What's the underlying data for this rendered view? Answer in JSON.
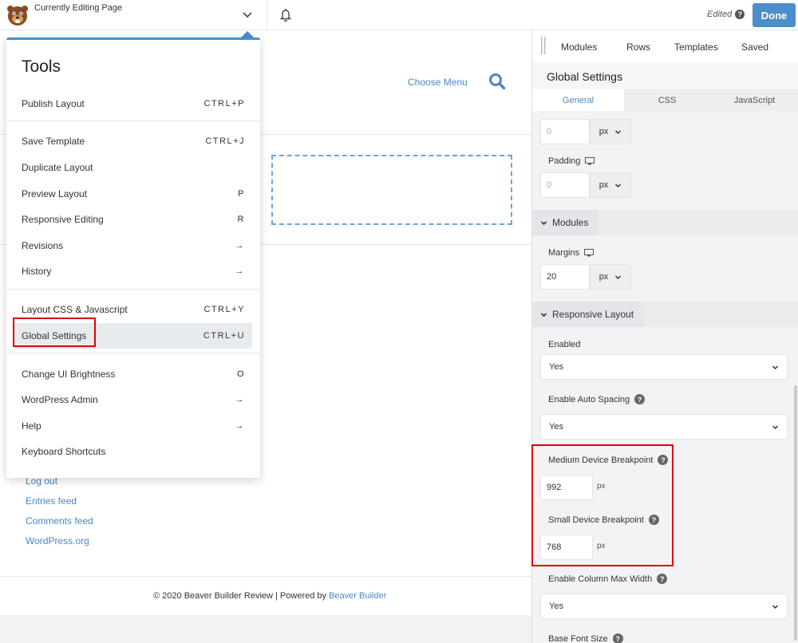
{
  "topbar": {
    "editing_label": "Currently Editing Page",
    "edited_label": "Edited",
    "done_label": "Done",
    "accent": "#4a8ecb"
  },
  "page": {
    "choose_menu": "Choose Menu",
    "links": [
      "Log out",
      "Entries feed",
      "Comments feed",
      "WordPress.org"
    ],
    "footer_text": "© 2020 Beaver Builder Review | Powered by ",
    "footer_link": "Beaver Builder"
  },
  "tools": {
    "title": "Tools",
    "items": [
      {
        "label": "Publish Layout",
        "shortcut": "CTRL+P"
      },
      {
        "label": "Save Template",
        "shortcut": "CTRL+J"
      },
      {
        "label": "Duplicate Layout",
        "shortcut": ""
      },
      {
        "label": "Preview Layout",
        "shortcut": "P"
      },
      {
        "label": "Responsive Editing",
        "shortcut": "R"
      },
      {
        "label": "Revisions",
        "shortcut": "→"
      },
      {
        "label": "History",
        "shortcut": "→"
      },
      {
        "label": "Layout CSS & Javascript",
        "shortcut": "CTRL+Y"
      },
      {
        "label": "Global Settings",
        "shortcut": "CTRL+U"
      },
      {
        "label": "Change UI Brightness",
        "shortcut": "O"
      },
      {
        "label": "WordPress Admin",
        "shortcut": "→"
      },
      {
        "label": "Help",
        "shortcut": "→"
      },
      {
        "label": "Keyboard Shortcuts",
        "shortcut": ""
      }
    ]
  },
  "panel": {
    "tabs": [
      "Modules",
      "Rows",
      "Templates",
      "Saved"
    ],
    "title": "Global Settings",
    "subtabs": [
      "General",
      "CSS",
      "JavaScript"
    ],
    "top_value": "0",
    "top_unit": "px",
    "padding_label": "Padding",
    "padding_value": "0",
    "padding_unit": "px",
    "modules_section": "Modules",
    "margins_label": "Margins",
    "margins_value": "20",
    "margins_unit": "px",
    "responsive_section": "Responsive Layout",
    "enabled_label": "Enabled",
    "enabled_value": "Yes",
    "auto_spacing_label": "Enable Auto Spacing",
    "auto_spacing_value": "Yes",
    "medium_label": "Medium Device Breakpoint",
    "medium_value": "992",
    "medium_unit": "px",
    "small_label": "Small Device Breakpoint",
    "small_value": "768",
    "small_unit": "px",
    "col_max_label": "Enable Column Max Width",
    "col_max_value": "Yes",
    "base_font_label": "Base Font Size"
  }
}
